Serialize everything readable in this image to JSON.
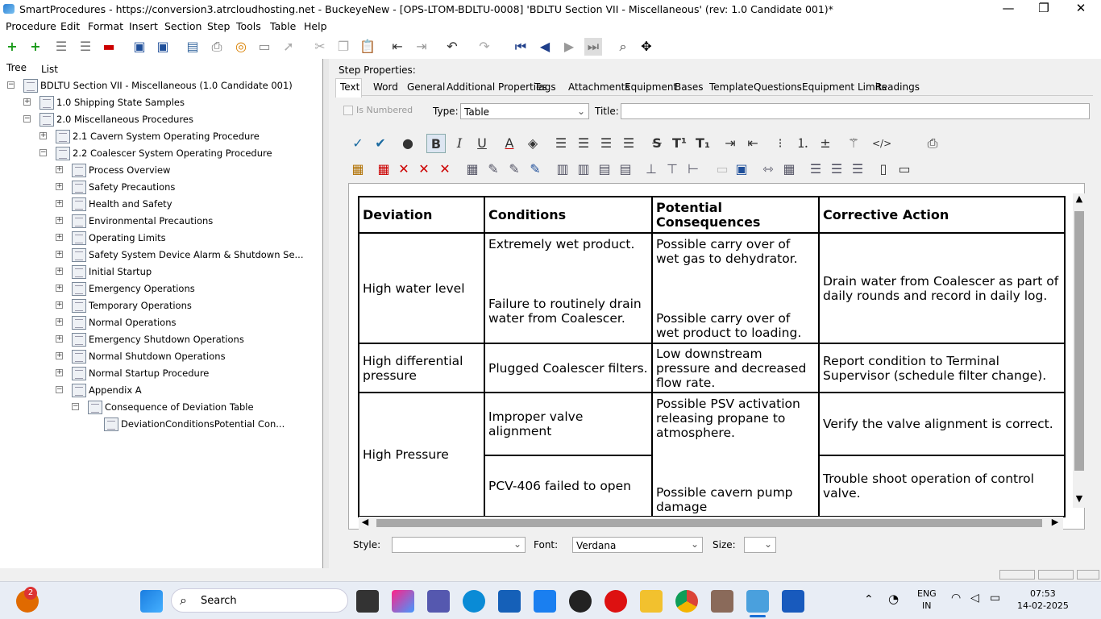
{
  "window": {
    "title": "SmartProcedures - https://conversion3.atrcloudhosting.net - BuckeyeNew - [OPS-LTOM-BDLTU-0008] 'BDLTU Section VII - Miscellaneous' (rev: 1.0 Candidate 001)*",
    "minimize": "—",
    "restore": "❐",
    "close": "✕"
  },
  "menu": [
    "Procedure",
    "Edit",
    "Format",
    "Insert",
    "Section",
    "Step",
    "Tools",
    "Table",
    "Help"
  ],
  "left_tabs": [
    "Tree",
    "List"
  ],
  "tree": [
    {
      "label": "BDLTU Section VII - Miscellaneous (1.0 Candidate 001)",
      "pm": "−",
      "level": 0
    },
    {
      "label": "1.0 Shipping State Samples",
      "pm": "+",
      "level": 1
    },
    {
      "label": "2.0 Miscellaneous Procedures",
      "pm": "−",
      "level": 1
    },
    {
      "label": "2.1 Cavern System Operating Procedure",
      "pm": "+",
      "level": 2
    },
    {
      "label": "2.2 Coalescer System Operating Procedure",
      "pm": "−",
      "level": 2
    },
    {
      "label": "Process Overview",
      "pm": "+",
      "level": 3
    },
    {
      "label": "Safety Precautions",
      "pm": "+",
      "level": 3
    },
    {
      "label": "Health and Safety",
      "pm": "+",
      "level": 3
    },
    {
      "label": "Environmental Precautions",
      "pm": "+",
      "level": 3
    },
    {
      "label": "Operating Limits",
      "pm": "+",
      "level": 3
    },
    {
      "label": "Safety System Device Alarm & Shutdown Se...",
      "pm": "+",
      "level": 3
    },
    {
      "label": "Initial Startup",
      "pm": "+",
      "level": 3
    },
    {
      "label": "Emergency Operations",
      "pm": "+",
      "level": 3
    },
    {
      "label": "Temporary Operations",
      "pm": "+",
      "level": 3
    },
    {
      "label": "Normal Operations",
      "pm": "+",
      "level": 3
    },
    {
      "label": "Emergency Shutdown Operations",
      "pm": "+",
      "level": 3
    },
    {
      "label": "Normal Shutdown Operations",
      "pm": "+",
      "level": 3
    },
    {
      "label": "Normal Startup Procedure",
      "pm": "+",
      "level": 3
    },
    {
      "label": "Appendix A",
      "pm": "−",
      "level": 3
    },
    {
      "label": "Consequence of Deviation Table",
      "pm": "−",
      "level": 4
    },
    {
      "label": "DeviationConditionsPotential Con...",
      "pm": "",
      "level": 5
    }
  ],
  "step_props_label": "Step Properties:",
  "step_tabs": [
    "Text",
    "Word",
    "General",
    "Additional Properties",
    "Tags",
    "Attachments",
    "Equipment",
    "Bases",
    "Template",
    "Questions",
    "Equipment Limits",
    "Readings"
  ],
  "is_numbered_label": "Is Numbered",
  "type_label": "Type:",
  "type_value": "Table",
  "title_label": "Title:",
  "title_value": "",
  "table": {
    "headers": [
      "Deviation",
      "Conditions",
      "Potential Consequences",
      "Corrective Action"
    ],
    "r1": {
      "deviation": "High water level",
      "cond1": "Extremely wet product.",
      "cond2": "Failure to routinely drain water from Coalescer.",
      "cons1": "Possible carry over of wet gas to dehydrator.",
      "cons2": "Possible carry over of wet product to loading.",
      "action": "Drain water from Coalescer as part of daily rounds and record in daily log."
    },
    "r2": {
      "deviation": "High differential pressure",
      "cond": "Plugged Coalescer filters.",
      "cons": "Low downstream pressure and decreased flow rate.",
      "action": "Report condition to Terminal Supervisor (schedule filter change)."
    },
    "r3": {
      "deviation": "High Pressure",
      "cond1": "Improper valve alignment",
      "cond2": "PCV-406 failed to open",
      "cons1": "Possible PSV activation releasing propane to atmosphere.",
      "cons2": "Possible cavern pump damage",
      "action1": "Verify the valve alignment is correct.",
      "action2": "Trouble shoot operation of control valve."
    }
  },
  "style_label": "Style:",
  "style_value": "",
  "font_label": "Font:",
  "font_value": "Verdana",
  "size_label": "Size:",
  "size_value": "",
  "taskbar": {
    "search": "Search",
    "lang1": "ENG",
    "lang2": "IN",
    "time": "07:53",
    "date": "14-02-2025",
    "badge": "2"
  }
}
